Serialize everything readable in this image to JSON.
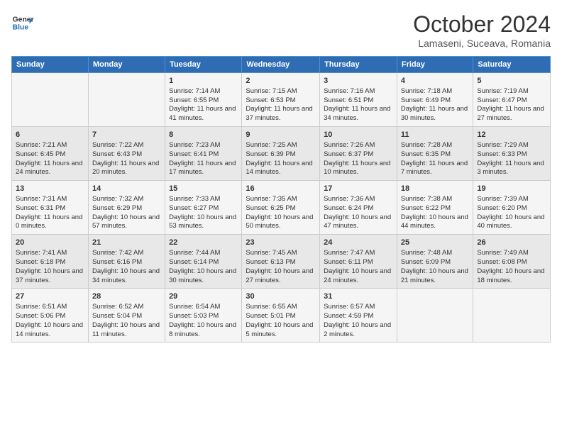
{
  "header": {
    "logo_line1": "General",
    "logo_line2": "Blue",
    "month": "October 2024",
    "location": "Lamaseni, Suceava, Romania"
  },
  "days_of_week": [
    "Sunday",
    "Monday",
    "Tuesday",
    "Wednesday",
    "Thursday",
    "Friday",
    "Saturday"
  ],
  "weeks": [
    [
      {
        "day": "",
        "content": ""
      },
      {
        "day": "",
        "content": ""
      },
      {
        "day": "1",
        "content": "Sunrise: 7:14 AM\nSunset: 6:55 PM\nDaylight: 11 hours and 41 minutes."
      },
      {
        "day": "2",
        "content": "Sunrise: 7:15 AM\nSunset: 6:53 PM\nDaylight: 11 hours and 37 minutes."
      },
      {
        "day": "3",
        "content": "Sunrise: 7:16 AM\nSunset: 6:51 PM\nDaylight: 11 hours and 34 minutes."
      },
      {
        "day": "4",
        "content": "Sunrise: 7:18 AM\nSunset: 6:49 PM\nDaylight: 11 hours and 30 minutes."
      },
      {
        "day": "5",
        "content": "Sunrise: 7:19 AM\nSunset: 6:47 PM\nDaylight: 11 hours and 27 minutes."
      }
    ],
    [
      {
        "day": "6",
        "content": "Sunrise: 7:21 AM\nSunset: 6:45 PM\nDaylight: 11 hours and 24 minutes."
      },
      {
        "day": "7",
        "content": "Sunrise: 7:22 AM\nSunset: 6:43 PM\nDaylight: 11 hours and 20 minutes."
      },
      {
        "day": "8",
        "content": "Sunrise: 7:23 AM\nSunset: 6:41 PM\nDaylight: 11 hours and 17 minutes."
      },
      {
        "day": "9",
        "content": "Sunrise: 7:25 AM\nSunset: 6:39 PM\nDaylight: 11 hours and 14 minutes."
      },
      {
        "day": "10",
        "content": "Sunrise: 7:26 AM\nSunset: 6:37 PM\nDaylight: 11 hours and 10 minutes."
      },
      {
        "day": "11",
        "content": "Sunrise: 7:28 AM\nSunset: 6:35 PM\nDaylight: 11 hours and 7 minutes."
      },
      {
        "day": "12",
        "content": "Sunrise: 7:29 AM\nSunset: 6:33 PM\nDaylight: 11 hours and 3 minutes."
      }
    ],
    [
      {
        "day": "13",
        "content": "Sunrise: 7:31 AM\nSunset: 6:31 PM\nDaylight: 11 hours and 0 minutes."
      },
      {
        "day": "14",
        "content": "Sunrise: 7:32 AM\nSunset: 6:29 PM\nDaylight: 10 hours and 57 minutes."
      },
      {
        "day": "15",
        "content": "Sunrise: 7:33 AM\nSunset: 6:27 PM\nDaylight: 10 hours and 53 minutes."
      },
      {
        "day": "16",
        "content": "Sunrise: 7:35 AM\nSunset: 6:25 PM\nDaylight: 10 hours and 50 minutes."
      },
      {
        "day": "17",
        "content": "Sunrise: 7:36 AM\nSunset: 6:24 PM\nDaylight: 10 hours and 47 minutes."
      },
      {
        "day": "18",
        "content": "Sunrise: 7:38 AM\nSunset: 6:22 PM\nDaylight: 10 hours and 44 minutes."
      },
      {
        "day": "19",
        "content": "Sunrise: 7:39 AM\nSunset: 6:20 PM\nDaylight: 10 hours and 40 minutes."
      }
    ],
    [
      {
        "day": "20",
        "content": "Sunrise: 7:41 AM\nSunset: 6:18 PM\nDaylight: 10 hours and 37 minutes."
      },
      {
        "day": "21",
        "content": "Sunrise: 7:42 AM\nSunset: 6:16 PM\nDaylight: 10 hours and 34 minutes."
      },
      {
        "day": "22",
        "content": "Sunrise: 7:44 AM\nSunset: 6:14 PM\nDaylight: 10 hours and 30 minutes."
      },
      {
        "day": "23",
        "content": "Sunrise: 7:45 AM\nSunset: 6:13 PM\nDaylight: 10 hours and 27 minutes."
      },
      {
        "day": "24",
        "content": "Sunrise: 7:47 AM\nSunset: 6:11 PM\nDaylight: 10 hours and 24 minutes."
      },
      {
        "day": "25",
        "content": "Sunrise: 7:48 AM\nSunset: 6:09 PM\nDaylight: 10 hours and 21 minutes."
      },
      {
        "day": "26",
        "content": "Sunrise: 7:49 AM\nSunset: 6:08 PM\nDaylight: 10 hours and 18 minutes."
      }
    ],
    [
      {
        "day": "27",
        "content": "Sunrise: 6:51 AM\nSunset: 5:06 PM\nDaylight: 10 hours and 14 minutes."
      },
      {
        "day": "28",
        "content": "Sunrise: 6:52 AM\nSunset: 5:04 PM\nDaylight: 10 hours and 11 minutes."
      },
      {
        "day": "29",
        "content": "Sunrise: 6:54 AM\nSunset: 5:03 PM\nDaylight: 10 hours and 8 minutes."
      },
      {
        "day": "30",
        "content": "Sunrise: 6:55 AM\nSunset: 5:01 PM\nDaylight: 10 hours and 5 minutes."
      },
      {
        "day": "31",
        "content": "Sunrise: 6:57 AM\nSunset: 4:59 PM\nDaylight: 10 hours and 2 minutes."
      },
      {
        "day": "",
        "content": ""
      },
      {
        "day": "",
        "content": ""
      }
    ]
  ]
}
